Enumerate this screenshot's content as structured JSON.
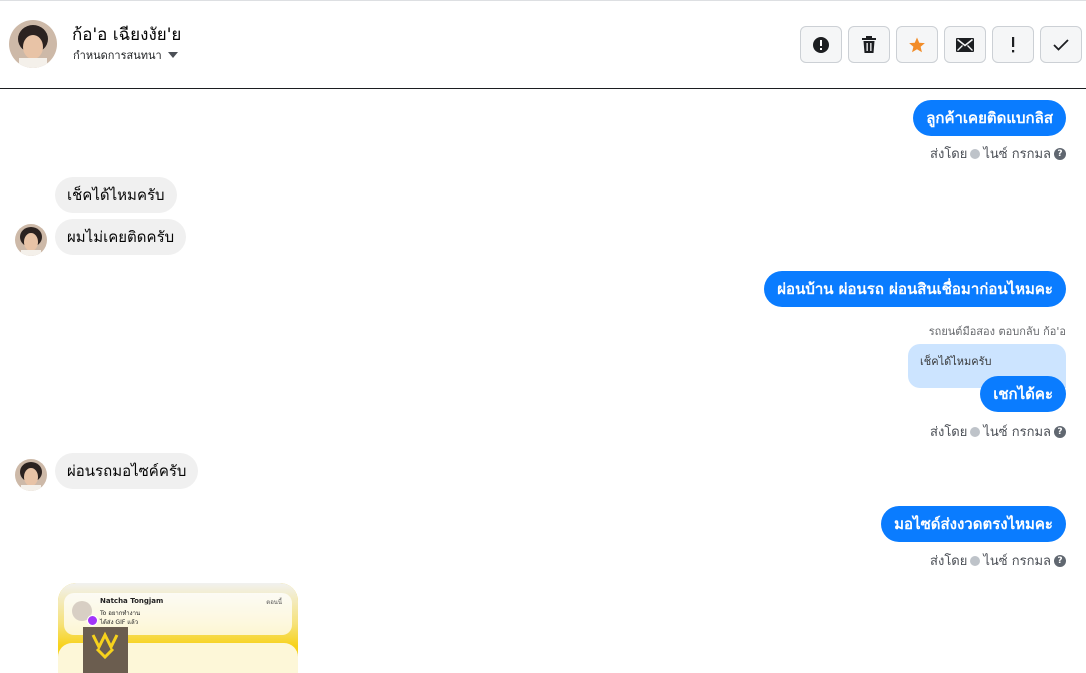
{
  "header": {
    "contact_name": "ก้อ'อ เฉียงงัย'ย",
    "assign_label": "กำหนดการสนทนา",
    "actions": [
      "info-icon",
      "trash-icon",
      "star-icon",
      "mail-icon",
      "exclamation-icon",
      "check-icon"
    ]
  },
  "colors": {
    "outgoing_bubble": "#0a7cff",
    "incoming_bubble": "#f0f0f0",
    "star": "#f28c28"
  },
  "messages": {
    "m1": "ลูกค้าเคยติดแบกลิส",
    "m2": "เช็คได้ไหมครับ",
    "m3": "ผมไม่เคยติดครับ",
    "m4": "ผ่อนบ้าน ผ่อนรถ ผ่อนสินเชื่อมาก่อนไหมคะ",
    "m5": "เชกได้คะ",
    "m6": "ผ่อนรถมอไซค์ครับ",
    "m7": "มอไซด์ส่งงวดตรงไหมคะ"
  },
  "meta": {
    "sent_by": "ส่งโดย",
    "agent": "ไนซ์ กรกมล",
    "help": "?"
  },
  "reply": {
    "label": "รถยนต์มือสอง ตอบกลับ ก้อ'อ",
    "quoted_text": "เช็คได้ไหมครับ"
  },
  "attachment": {
    "sender": "Natcha Tongjam",
    "time": "ตอนนี้",
    "line1": "To อยากทำงาน",
    "line2": "ได้ส่ง GIF แล้ว"
  }
}
